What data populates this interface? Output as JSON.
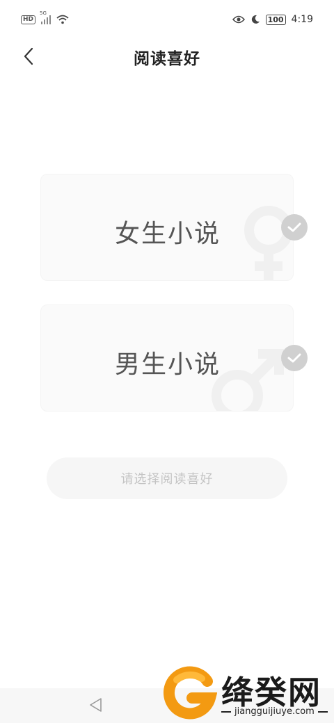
{
  "status_bar": {
    "hd": "HD",
    "network": "5G",
    "battery": "100",
    "time": "4:19"
  },
  "header": {
    "title": "阅读喜好"
  },
  "options": [
    {
      "label": "女生小说",
      "selected": false
    },
    {
      "label": "男生小说",
      "selected": false
    }
  ],
  "confirm_button": {
    "label": "请选择阅读喜好",
    "enabled": false
  },
  "watermark": {
    "name": "绛癸网",
    "url": "jiangguijiuye.com"
  },
  "colors": {
    "check_inactive": "#d0d0d0",
    "card_bg": "#fafafa",
    "button_bg": "#f6f6f6",
    "button_text": "#c4c4c4",
    "brand_orange": "#f39a12"
  },
  "icons": {
    "back": "chevron-left-icon",
    "check": "check-icon",
    "female": "female-symbol-icon",
    "male": "male-symbol-icon",
    "nav_back": "triangle-back-icon"
  }
}
